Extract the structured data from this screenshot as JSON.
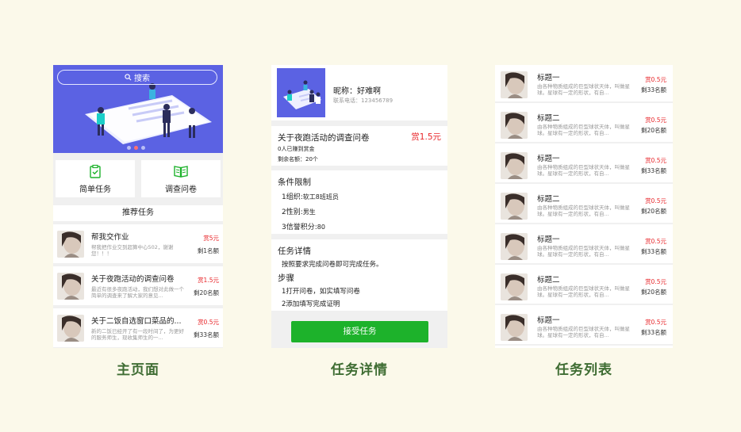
{
  "home": {
    "caption": "主页面",
    "search_label": "搜索",
    "categories": [
      {
        "label": "简单任务",
        "icon": "clipboard-check-icon"
      },
      {
        "label": "调查问卷",
        "icon": "open-book-icon"
      }
    ],
    "recommend_title": "推荐任务",
    "tasks": [
      {
        "title": "帮我交作业",
        "desc": "帮我把作业交到超算中心502，谢谢您！！！",
        "reward": "赏5元",
        "remain": "剩1名额"
      },
      {
        "title": "关于夜跑活动的调查问卷",
        "desc": "最近有很多夜跑活动，我们想对此做一个简单的调查来了解大家的意见...",
        "reward": "赏1.5元",
        "remain": "剩20名额"
      },
      {
        "title": "关于二饭自选窗口菜品的...",
        "desc": "新的二饭已经开了有一段时间了，为更好的服务师生，现收集师生的一...",
        "reward": "赏0.5元",
        "remain": "剩33名额"
      }
    ]
  },
  "detail": {
    "caption": "任务详情",
    "nickname": "昵称：好难啊",
    "phone": "联系电话：123456789",
    "task_title": "关于夜跑活动的调查问卷",
    "reward": "赏1.5元",
    "earned": "0人已赚到赏金",
    "remaining": "剩余名额：20个",
    "conditions_title": "条件限制",
    "conditions": [
      {
        "label": "1组织:",
        "value": "软工8班班员"
      },
      {
        "label": "2性别:",
        "value": "男生"
      },
      {
        "label": "3信誉积分:",
        "value": "80"
      }
    ],
    "details_title": "任务详情",
    "details_text": "按照要求完成问卷即可完成任务。",
    "steps_title": "步骤",
    "steps": [
      "1打开问卷，如实填写问卷",
      "2添加填写完成证明"
    ],
    "accept_label": "接受任务"
  },
  "list": {
    "caption": "任务列表",
    "items": [
      {
        "title": "标题一",
        "desc": "由各种物质组成的巨型球状天体，叫做星球。星球有一定的形状，有自...",
        "reward": "赏0.5元",
        "remain": "剩33名额"
      },
      {
        "title": "标题二",
        "desc": "由各种物质组成的巨型球状天体，叫做星球。星球有一定的形状，有自...",
        "reward": "赏0.5元",
        "remain": "剩20名额"
      },
      {
        "title": "标题一",
        "desc": "由各种物质组成的巨型球状天体，叫做星球。星球有一定的形状，有自...",
        "reward": "赏0.5元",
        "remain": "剩33名额"
      },
      {
        "title": "标题二",
        "desc": "由各种物质组成的巨型球状天体，叫做星球。星球有一定的形状，有自...",
        "reward": "赏0.5元",
        "remain": "剩20名额"
      },
      {
        "title": "标题一",
        "desc": "由各种物质组成的巨型球状天体，叫做星球。星球有一定的形状，有自...",
        "reward": "赏0.5元",
        "remain": "剩33名额"
      },
      {
        "title": "标题二",
        "desc": "由各种物质组成的巨型球状天体，叫做星球。星球有一定的形状，有自...",
        "reward": "赏0.5元",
        "remain": "剩20名额"
      },
      {
        "title": "标题一",
        "desc": "由各种物质组成的巨型球状天体，叫做星球。星球有一定的形状，有自...",
        "reward": "赏0.5元",
        "remain": "剩33名额"
      }
    ]
  },
  "colors": {
    "banner": "#5b62e3",
    "reward": "#e8262a",
    "accept": "#1db22b",
    "caption": "#3f6d33",
    "background": "#fbf9ea"
  }
}
